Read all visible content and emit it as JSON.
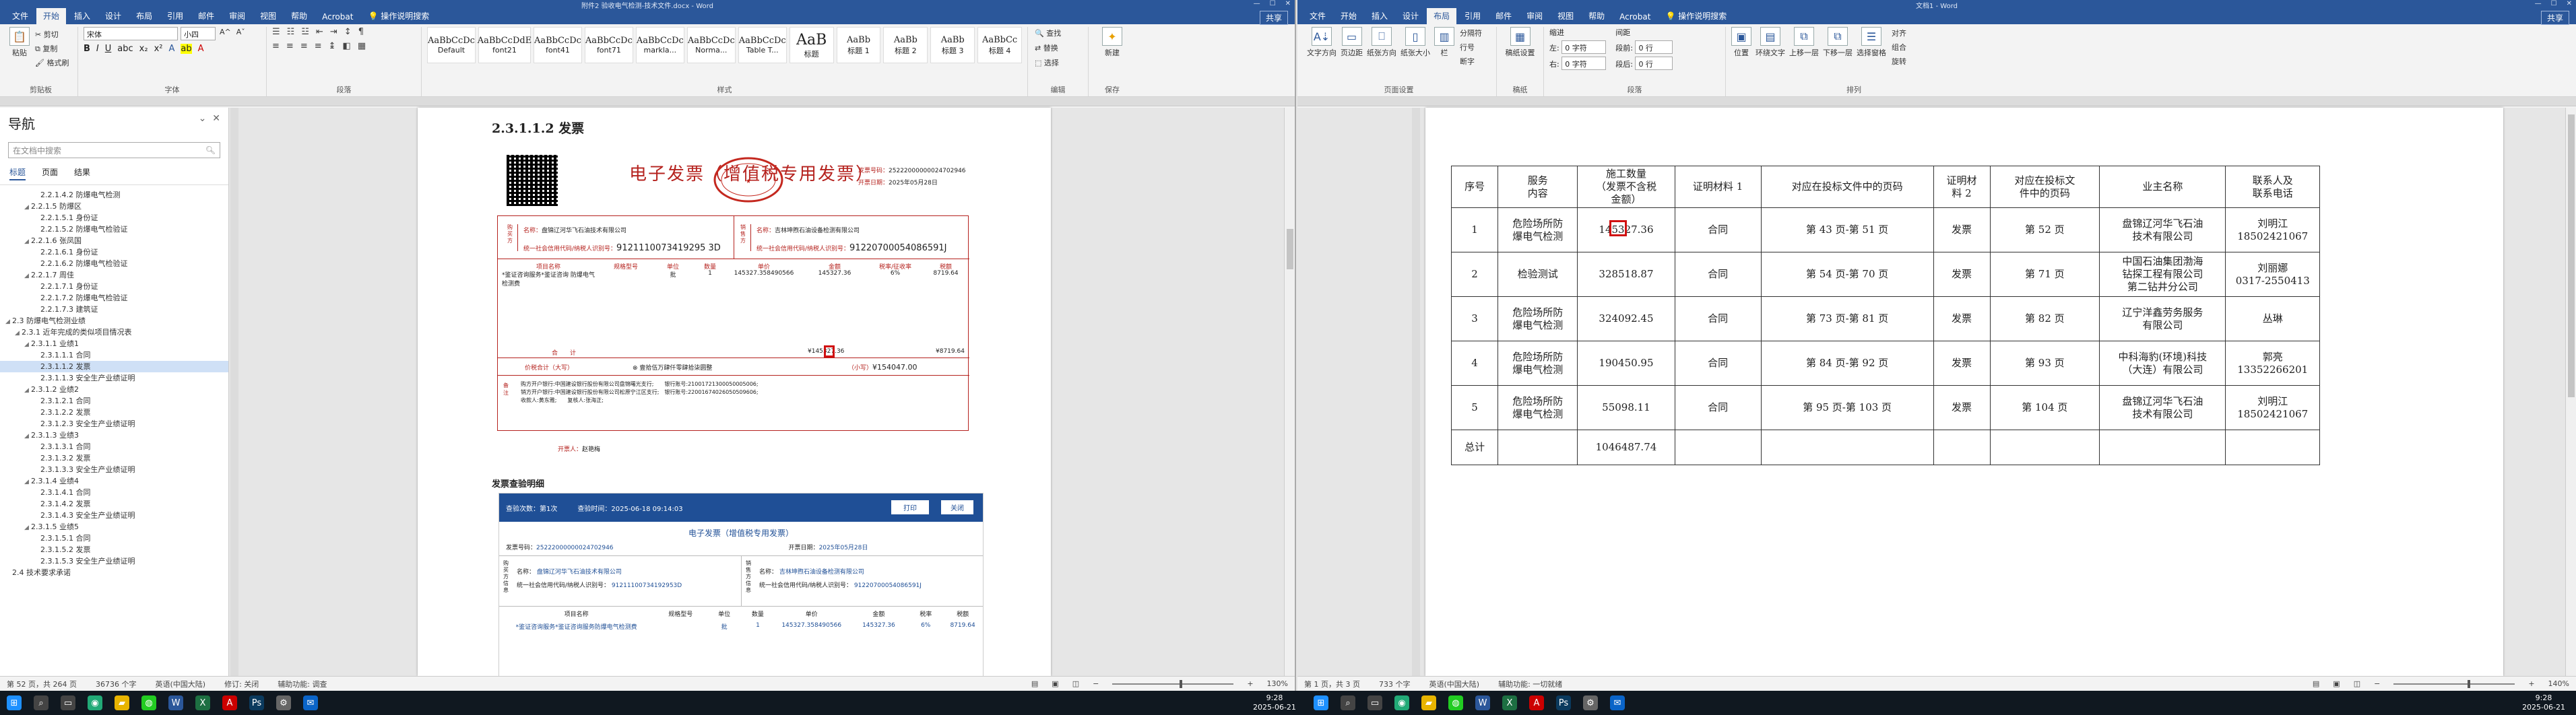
{
  "left": {
    "titlebar": "附件2 验收电气检测-技术文件.docx - Word",
    "tabs": [
      "文件",
      "开始",
      "插入",
      "设计",
      "布局",
      "引用",
      "邮件",
      "审阅",
      "视图",
      "帮助",
      "Acrobat"
    ],
    "active_tab": "开始",
    "tellme": "操作说明搜索",
    "share": "共享",
    "ribbon": {
      "clipboard_label": "剪贴板",
      "paste": "粘贴",
      "cut": "剪切",
      "copy": "复制",
      "format_painter": "格式刷",
      "font_label": "字体",
      "font_name": "宋体",
      "font_size": "小四",
      "paragraph_label": "段落",
      "styles_label": "样式",
      "editing_label": "编辑",
      "find": "查找",
      "replace": "替换",
      "select": "选择",
      "save_label": "保存",
      "new_label": "新建",
      "styles": [
        {
          "preview": "AaBbCcDc",
          "name": "Default"
        },
        {
          "preview": "AaBbCcDdE",
          "name": "font21"
        },
        {
          "preview": "AaBbCcDc",
          "name": "font41"
        },
        {
          "preview": "AaBbCcDc",
          "name": "font71"
        },
        {
          "preview": "AaBbCcDc",
          "name": "markla..."
        },
        {
          "preview": "AaBbCcDc",
          "name": "Norma..."
        },
        {
          "preview": "AaBbCcDc",
          "name": "Table T..."
        },
        {
          "preview": "AaB",
          "name": "标题"
        },
        {
          "preview": "AaBb",
          "name": "标题 1"
        },
        {
          "preview": "AaBb",
          "name": "标题 2"
        },
        {
          "preview": "AaBb",
          "name": "标题 3"
        },
        {
          "preview": "AaBbCc",
          "name": "标题 4"
        }
      ]
    },
    "nav": {
      "title": "导航",
      "search_placeholder": "在文档中搜索",
      "tabs": [
        "标题",
        "页面",
        "结果"
      ],
      "items": [
        {
          "t": "2.2.1.4.2 防爆电气检测",
          "lvl": 4,
          "exp": false
        },
        {
          "t": "2.2.1.5 防爆区",
          "lvl": 3,
          "exp": true
        },
        {
          "t": "2.2.1.5.1 身份证",
          "lvl": 4,
          "exp": false
        },
        {
          "t": "2.2.1.5.2 防爆电气检验证",
          "lvl": 4,
          "exp": false
        },
        {
          "t": "2.2.1.6 张凤国",
          "lvl": 3,
          "exp": true
        },
        {
          "t": "2.2.1.6.1 身份证",
          "lvl": 4,
          "exp": false
        },
        {
          "t": "2.2.1.6.2 防爆电气检验证",
          "lvl": 4,
          "exp": false
        },
        {
          "t": "2.2.1.7 周佳",
          "lvl": 3,
          "exp": true
        },
        {
          "t": "2.2.1.7.1 身份证",
          "lvl": 4,
          "exp": false
        },
        {
          "t": "2.2.1.7.2 防爆电气检验证",
          "lvl": 4,
          "exp": false
        },
        {
          "t": "2.2.1.7.3 建筑证",
          "lvl": 4,
          "exp": false
        },
        {
          "t": "2.3 防爆电气检测业绩",
          "lvl": 1,
          "exp": true
        },
        {
          "t": "2.3.1 近年完成的类似项目情况表",
          "lvl": 2,
          "exp": true
        },
        {
          "t": "2.3.1.1 业绩1",
          "lvl": 3,
          "exp": true
        },
        {
          "t": "2.3.1.1.1 合同",
          "lvl": 4,
          "exp": false
        },
        {
          "t": "2.3.1.1.2 发票",
          "lvl": 4,
          "exp": false,
          "sel": true
        },
        {
          "t": "2.3.1.1.3 安全生产业绩证明",
          "lvl": 4,
          "exp": false
        },
        {
          "t": "2.3.1.2 业绩2",
          "lvl": 3,
          "exp": true
        },
        {
          "t": "2.3.1.2.1 合同",
          "lvl": 4,
          "exp": false
        },
        {
          "t": "2.3.1.2.2 发票",
          "lvl": 4,
          "exp": false
        },
        {
          "t": "2.3.1.2.3 安全生产业绩证明",
          "lvl": 4,
          "exp": false
        },
        {
          "t": "2.3.1.3 业绩3",
          "lvl": 3,
          "exp": true
        },
        {
          "t": "2.3.1.3.1 合同",
          "lvl": 4,
          "exp": false
        },
        {
          "t": "2.3.1.3.2 发票",
          "lvl": 4,
          "exp": false
        },
        {
          "t": "2.3.1.3.3 安全生产业绩证明",
          "lvl": 4,
          "exp": false
        },
        {
          "t": "2.3.1.4 业绩4",
          "lvl": 3,
          "exp": true
        },
        {
          "t": "2.3.1.4.1 合同",
          "lvl": 4,
          "exp": false
        },
        {
          "t": "2.3.1.4.2 发票",
          "lvl": 4,
          "exp": false
        },
        {
          "t": "2.3.1.4.3 安全生产业绩证明",
          "lvl": 4,
          "exp": false
        },
        {
          "t": "2.3.1.5 业绩5",
          "lvl": 3,
          "exp": true
        },
        {
          "t": "2.3.1.5.1 合同",
          "lvl": 4,
          "exp": false
        },
        {
          "t": "2.3.1.5.2 发票",
          "lvl": 4,
          "exp": false
        },
        {
          "t": "2.3.1.5.3 安全生产业绩证明",
          "lvl": 4,
          "exp": false
        },
        {
          "t": "2.4 技术要求承诺",
          "lvl": 1,
          "exp": false
        }
      ]
    },
    "heading": "2.3.1.1.2 发票",
    "invoice": {
      "title": "电子发票（增值税专用发票）",
      "no_label": "发票号码：",
      "no": "25222000000024702946",
      "date_label": "开票日期：",
      "date": "2025年05月28日",
      "buyer_name_label": "名称：",
      "buyer_name": "盘锦辽河华飞石油技术有限公司",
      "buyer_id_label": "统一社会信用代码/纳税人识别号：",
      "buyer_id": "9121110073419295 3D",
      "seller_name": "吉林坤煦石油设备检测有限公司",
      "seller_id": "91220700054086591J",
      "cols": [
        "项目名称",
        "规格型号",
        "单位",
        "数量",
        "单价",
        "金额",
        "税率/征收率",
        "税额"
      ],
      "item_name": "*鉴证咨询服务*鉴证咨询 防爆电气检测费",
      "item_unit": "批",
      "item_qty": "1",
      "item_price": "145327.358490566",
      "item_amount": "145327.36",
      "item_rate": "6%",
      "item_tax": "8719.64",
      "total_label": "合　　计",
      "total_amount": "¥145327.36",
      "total_tax": "¥8719.64",
      "total_words_label": "价税合计（大写）",
      "total_words": "壹拾伍万肆仟零肆拾柒圆整",
      "total_small_label": "（小写）",
      "total_small": "¥154047.00",
      "remarks": "购方开户银行:中国建设银行股份有限公司盘锦曙光支行;　　银行账号:21001721300050005006;",
      "remarks2": "销方开户银行:中国建设银行股份有限公司松原宁江区支行;　银行账号:22001674026050509606;",
      "remarks3": "收款人:黄东雅;　　复核人:张海正;",
      "drawer_label": "开票人：",
      "drawer": "赵艳梅"
    },
    "verify": {
      "heading": "发票查验明细",
      "count_label": "查验次数：第1次",
      "time_label": "查验时间：",
      "time": "2025-06-18 09:14:03",
      "print_btn": "打印",
      "close_btn": "关闭",
      "title": "电子发票（增值税专用发票）",
      "no_label": "发票号码：",
      "no": "25222000000024702946",
      "date_label": "开票日期：",
      "date": "2025年05月28日",
      "buyer_label": "购买方信息",
      "seller_label": "销售方信息",
      "name_label": "名称：",
      "buyer": "盘锦辽河华飞石油技术有限公司",
      "seller": "吉林坤煦石油设备检测有限公司",
      "id_label": "统一社会信用代码/纳税人识别号：",
      "buyer_id": "91211100734192953D",
      "seller_id": "91220700054086591J",
      "cols": [
        "项目名称",
        "规格型号",
        "单位",
        "数量",
        "单价",
        "金额",
        "税率",
        "税额"
      ],
      "row": [
        "*鉴证咨询服务*鉴证咨询服务防爆电气检测费",
        "",
        "批",
        "1",
        "145327.358490566",
        "145327.36",
        "6%",
        "8719.64"
      ]
    },
    "status": {
      "page": "第 52 页，共 264 页",
      "words": "36736 个字",
      "lang": "英语(中国大陆)",
      "track": "修订: 关闭",
      "access": "辅助功能: 调查",
      "zoom": "130%"
    }
  },
  "right": {
    "titlebar": "文档1 - Word",
    "tabs": [
      "文件",
      "开始",
      "插入",
      "设计",
      "布局",
      "引用",
      "邮件",
      "审阅",
      "视图",
      "帮助",
      "Acrobat"
    ],
    "active_tab": "布局",
    "tellme": "操作说明搜索",
    "share": "共享",
    "ribbon": {
      "page_setup_label": "页面设置",
      "text_direction": "文字方向",
      "margins": "页边距",
      "orientation": "纸张方向",
      "size": "纸张大小",
      "columns": "栏",
      "breaks": "分隔符",
      "line_numbers": "行号",
      "hyphenation": "断字",
      "draft_label": "稿纸",
      "draft": "稿纸设置",
      "paragraph_label": "段落",
      "indent": "缩进",
      "spacing": "间距",
      "left_label": "左:",
      "left_val": "0 字符",
      "right_label": "右:",
      "right_val": "0 字符",
      "before_label": "段前:",
      "before_val": "0 行",
      "after_label": "段后:",
      "after_val": "0 行",
      "arrange_label": "排列",
      "position": "位置",
      "wrap": "环绕文字",
      "forward": "上移一层",
      "backward": "下移一层",
      "pane": "选择窗格",
      "align": "对齐",
      "group": "组合",
      "rotate": "旋转"
    },
    "table": {
      "headers": [
        "序号",
        "服务\n内容",
        "施工数量\n（发票不含税\n金额）",
        "证明材料 1",
        "对应在投标文件中的页码",
        "证明材\n料 2",
        "对应在投标文\n件中的页码",
        "业主名称",
        "联系人及\n联系电话"
      ],
      "rows": [
        [
          "1",
          "危险场所防\n爆电气检测",
          "145327.36",
          "合同",
          "第 43 页-第 51 页",
          "发票",
          "第 52 页",
          "盘锦辽河华飞石油\n技术有限公司",
          "刘明江\n18502421067"
        ],
        [
          "2",
          "检验测试",
          "328518.87",
          "合同",
          "第 54 页-第 70 页",
          "发票",
          "第 71 页",
          "中国石油集团渤海\n钻探工程有限公司\n第二钻井分公司",
          "刘丽娜\n0317-2550413"
        ],
        [
          "3",
          "危险场所防\n爆电气检测",
          "324092.45",
          "合同",
          "第 73 页-第 81 页",
          "发票",
          "第 82 页",
          "辽宁洋鑫劳务服务\n有限公司",
          "丛琳"
        ],
        [
          "4",
          "危险场所防\n爆电气检测",
          "190450.95",
          "合同",
          "第 84 页-第 92 页",
          "发票",
          "第 93 页",
          "中科海豹(环境)科技\n（大连）有限公司",
          "郭亮\n13352266201"
        ],
        [
          "5",
          "危险场所防\n爆电气检测",
          "55098.11",
          "合同",
          "第 95 页-第 103 页",
          "发票",
          "第 104 页",
          "盘锦辽河华飞石油\n技术有限公司",
          "刘明江\n18502421067"
        ]
      ],
      "total_label": "总计",
      "total": "1046487.74"
    },
    "status": {
      "page": "第 1 页，共 3 页",
      "words": "733 个字",
      "lang": "英语(中国大陆)",
      "access": "辅助功能: 一切就绪",
      "zoom": "140%"
    }
  },
  "taskbar": {
    "time_left": "9:28",
    "date_left": "2025-06-21",
    "time_right": "9:28",
    "date_right": "2025-06-21"
  }
}
